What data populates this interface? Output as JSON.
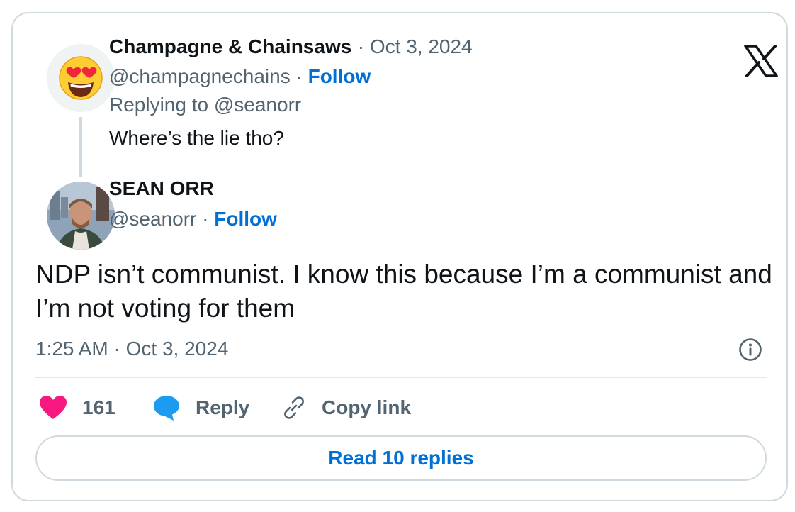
{
  "reply_tweet": {
    "avatar_icon": "heart-eyes-emoji-icon",
    "display_name": "Champagne & Chainsaws",
    "date": "· Oct 3, 2024",
    "handle": "@champagnechains",
    "separator": " · ",
    "follow_label": "Follow",
    "replying_to": "Replying to @seanorr",
    "text": "Where’s the lie tho?"
  },
  "main_tweet": {
    "display_name": "SEAN ORR",
    "handle": "@seanorr",
    "separator": " · ",
    "follow_label": "Follow",
    "text": "NDP isn’t communist. I know this because I’m a communist and I’m not voting for them",
    "timestamp": "1:25 AM · Oct 3, 2024"
  },
  "actions": {
    "like_count": "161",
    "reply_label": "Reply",
    "copy_link_label": "Copy link"
  },
  "read_replies_label": "Read 10 replies",
  "colors": {
    "link_blue": "#006fd6",
    "like_pink": "#f91880",
    "reply_blue": "#1d9bf0",
    "muted": "#536471",
    "border": "#cfd9de"
  },
  "icons": {
    "brand": "x-logo-icon",
    "info": "info-icon",
    "like": "heart-icon",
    "reply": "speech-bubble-icon",
    "copy": "link-icon"
  }
}
